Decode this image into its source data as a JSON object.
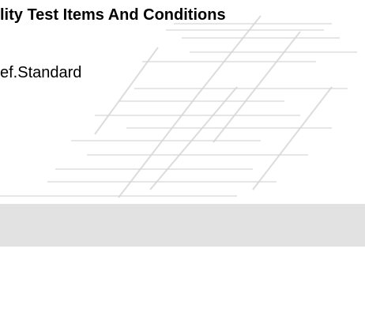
{
  "document": {
    "title": "lity Test Items And Conditions",
    "ref_standard": "ef.Standard"
  },
  "colors": {
    "background": "#ffffff",
    "text": "#000000",
    "watermark_stroke": "#c8c8c8",
    "grey_band": "#e2e2e2"
  }
}
